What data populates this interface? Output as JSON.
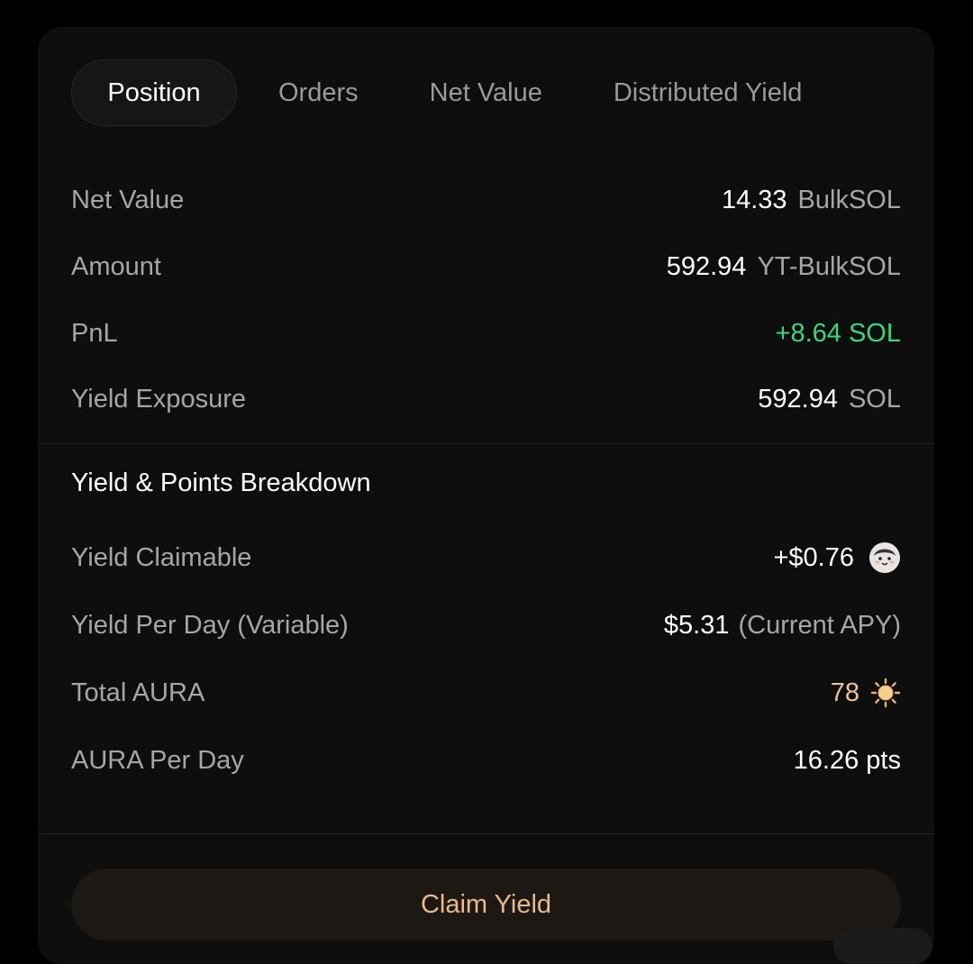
{
  "tabs": [
    {
      "label": "Position",
      "active": true
    },
    {
      "label": "Orders",
      "active": false
    },
    {
      "label": "Net Value",
      "active": false
    },
    {
      "label": "Distributed Yield",
      "active": false
    }
  ],
  "position": {
    "net_value": {
      "label": "Net Value",
      "value": "14.33",
      "unit": "BulkSOL"
    },
    "amount": {
      "label": "Amount",
      "value": "592.94",
      "unit": "YT-BulkSOL"
    },
    "pnl": {
      "label": "PnL",
      "value": "+8.64 SOL",
      "color": "#3fd47a"
    },
    "yield_exposure": {
      "label": "Yield Exposure",
      "value": "592.94",
      "unit": "SOL"
    }
  },
  "breakdown": {
    "title": "Yield & Points Breakdown",
    "yield_claimable": {
      "label": "Yield Claimable",
      "value": "+$0.76",
      "icon": "token-avatar-icon"
    },
    "yield_per_day": {
      "label": "Yield Per Day (Variable)",
      "value": "$5.31",
      "note": "(Current APY)"
    },
    "total_aura": {
      "label": "Total AURA",
      "value": "78",
      "icon": "sun-icon",
      "color": "#efc193"
    },
    "aura_per_day": {
      "label": "AURA Per Day",
      "value": "16.26 pts"
    }
  },
  "claim_button": {
    "label": "Claim Yield",
    "color": "#e7b98c"
  }
}
